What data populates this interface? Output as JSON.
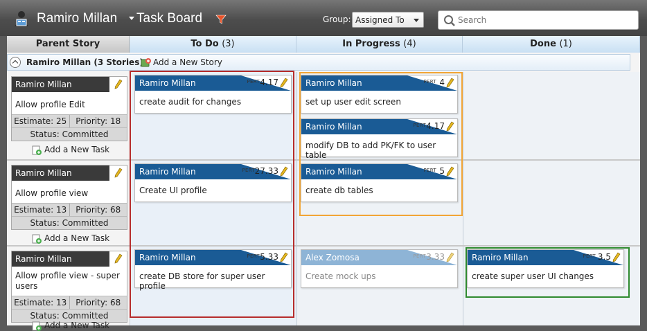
{
  "header": {
    "user_name": "Ramiro Millan",
    "board_title": "Task Board",
    "group_label": "Group:",
    "group_value": "Assigned To",
    "search_placeholder": "Search"
  },
  "columns": [
    {
      "label": "Parent Story",
      "count": ""
    },
    {
      "label": "To Do",
      "count": "(3)"
    },
    {
      "label": "In Progress",
      "count": "(4)"
    },
    {
      "label": "Done",
      "count": "(1)"
    }
  ],
  "group": {
    "title": "Ramiro Millan (3 Stories)",
    "add_story": "Add a New Story"
  },
  "stories": [
    {
      "owner": "Ramiro Millan",
      "title": "Allow profile Edit",
      "estimate": "Estimate: 25",
      "priority": "Priority: 18",
      "status": "Status: Committed",
      "add_task": "Add a New Task"
    },
    {
      "owner": "Ramiro Millan",
      "title": "Allow profile view",
      "estimate": "Estimate: 13",
      "priority": "Priority: 68",
      "status": "Status: Committed",
      "add_task": "Add a New Task"
    },
    {
      "owner": "Ramiro Millan",
      "title": "Allow profile view - super users",
      "estimate": "Estimate: 13",
      "priority": "Priority: 68",
      "status": "Status: Committed",
      "add_task": "Add a New Task"
    }
  ],
  "tasks": {
    "pert_label": "PERT",
    "todo": [
      {
        "owner": "Ramiro Millan",
        "pert": "4.17",
        "title": "create audit for changes"
      },
      {
        "owner": "Ramiro Millan",
        "pert": "27.33",
        "title": "Create UI profile"
      },
      {
        "owner": "Ramiro Millan",
        "pert": "5.33",
        "title": "create DB store for super user profile"
      }
    ],
    "in_progress": [
      {
        "owner": "Ramiro Millan",
        "pert": "4",
        "title": "set up user edit screen"
      },
      {
        "owner": "Ramiro Millan",
        "pert": "4.17",
        "title": "modify DB to add PK/FK to user table"
      },
      {
        "owner": "Ramiro Millan",
        "pert": "5",
        "title": "create db tables"
      },
      {
        "owner": "Alex Zomosa",
        "pert": "3.33",
        "title": "Create mock ups"
      }
    ],
    "done": [
      {
        "owner": "Ramiro Millan",
        "pert": "3.5",
        "title": "create super user UI changes"
      }
    ]
  },
  "colors": {
    "task_header": "#1a5b95",
    "task_header_faded": "#8eb4d6",
    "story_header": "#3a3a3a",
    "highlight_todo": "#b62c2c",
    "highlight_in_progress": "#f2a535",
    "highlight_done": "#2f8a2f"
  }
}
